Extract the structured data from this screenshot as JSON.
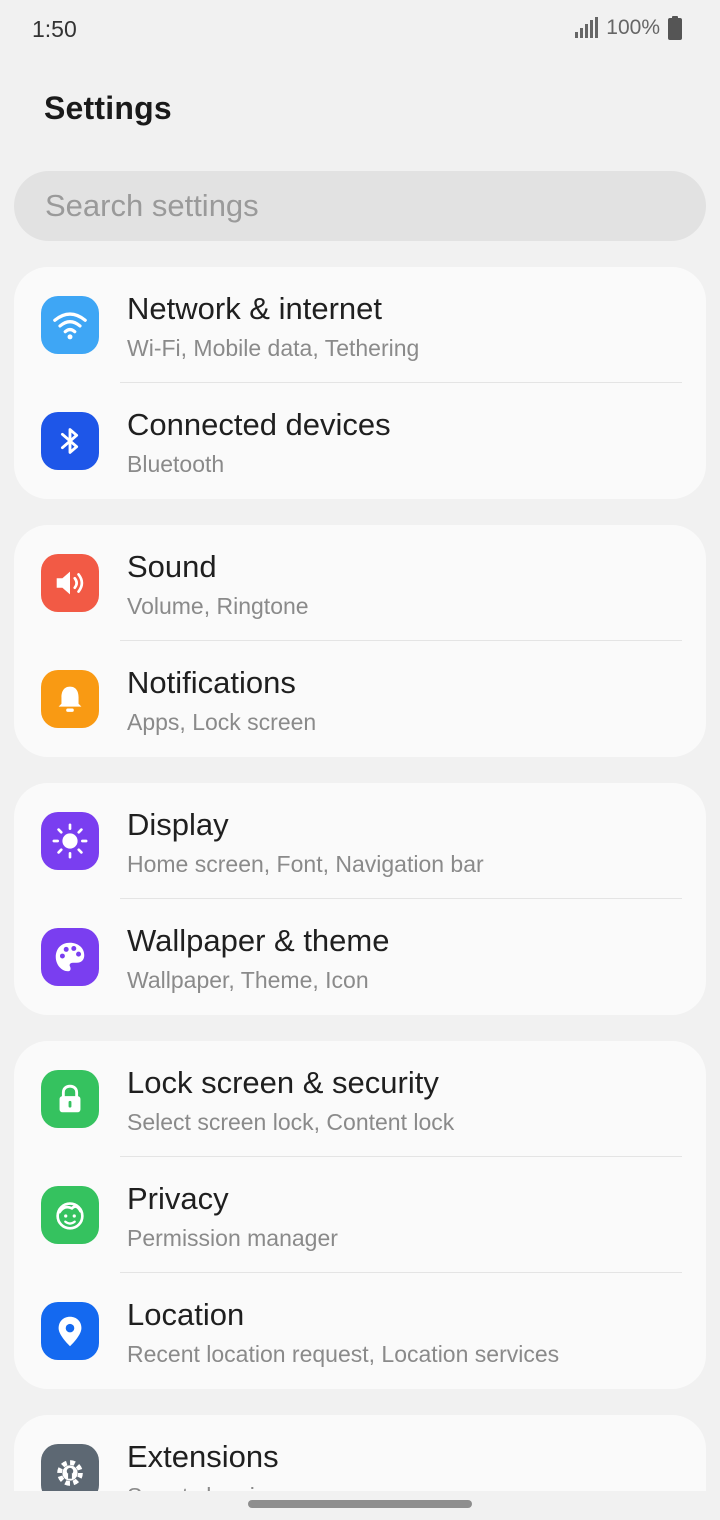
{
  "status_bar": {
    "time": "1:50",
    "battery_text": "100%"
  },
  "header": {
    "title": "Settings"
  },
  "search": {
    "placeholder": "Search settings"
  },
  "groups": [
    {
      "items": [
        {
          "title": "Network & internet",
          "subtitle": "Wi-Fi, Mobile data, Tethering",
          "icon": "wifi-icon",
          "color": "#3ea6f5"
        },
        {
          "title": "Connected devices",
          "subtitle": "Bluetooth",
          "icon": "bluetooth-icon",
          "color": "#1e56e8"
        }
      ]
    },
    {
      "items": [
        {
          "title": "Sound",
          "subtitle": "Volume, Ringtone",
          "icon": "speaker-icon",
          "color": "#f25a45"
        },
        {
          "title": "Notifications",
          "subtitle": "Apps, Lock screen",
          "icon": "bell-icon",
          "color": "#f99a13"
        }
      ]
    },
    {
      "items": [
        {
          "title": "Display",
          "subtitle": "Home screen, Font, Navigation bar",
          "icon": "brightness-icon",
          "color": "#7a3ef0"
        },
        {
          "title": "Wallpaper & theme",
          "subtitle": "Wallpaper, Theme, Icon",
          "icon": "palette-icon",
          "color": "#7a3ef0"
        }
      ]
    },
    {
      "items": [
        {
          "title": "Lock screen & security",
          "subtitle": "Select screen lock, Content lock",
          "icon": "lock-icon",
          "color": "#35c25f"
        },
        {
          "title": "Privacy",
          "subtitle": "Permission manager",
          "icon": "privacy-face-icon",
          "color": "#35c25f"
        },
        {
          "title": "Location",
          "subtitle": "Recent location request, Location services",
          "icon": "location-pin-icon",
          "color": "#1469f0"
        }
      ]
    },
    {
      "items": [
        {
          "title": "Extensions",
          "subtitle": "Smart cleaning",
          "icon": "gear-bulb-icon",
          "color": "#5d6873"
        }
      ]
    }
  ]
}
